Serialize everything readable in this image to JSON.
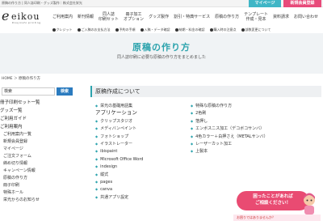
{
  "topbar": {
    "tagline": "原稿の作り方 | 同人誌印刷・グッズ製作｜株式会社栄光",
    "mypage": "マイページ",
    "register": "新規会員登録"
  },
  "header": {
    "logo_mark": "e",
    "logo_word": "eikou",
    "logo_sub": "Doujinshi printing",
    "nav": [
      "ご利用案内",
      "新刊情報",
      "同人誌\n印刷セット",
      "冊子加工\nオプション",
      "グッズ製作",
      "割引・特典サービス",
      "原稿の作り方",
      "テンプレート\n作成・見本",
      "資料請求",
      "お問い合わせ"
    ]
  },
  "subnav": [
    "クレジット",
    "ご入稿のお支払方法",
    "予約の手順",
    "入稿・データ確認",
    "納期・料金の確認",
    "購入時の注意点",
    "部数変更について"
  ],
  "hero": {
    "title": "原稿の作り方",
    "subtitle": "同人誌印刷に必要な原稿の作り方をまとめました"
  },
  "breadcrumb": "HOME ＞ 原稿の作り方",
  "sidebar": {
    "search_value": "検索",
    "search_button": "検索",
    "items": [
      {
        "label": "冊子印刷セット一覧",
        "sub": false
      },
      {
        "label": "グッズ一覧",
        "sub": false
      },
      {
        "label": "ご利用ガイド",
        "sub": false
      },
      {
        "label": "ご利用案内",
        "sub": false
      },
      {
        "label": "ご利用案内一覧",
        "sub": true
      },
      {
        "label": "新規会員登録",
        "sub": true
      },
      {
        "label": "マイページ",
        "sub": true
      },
      {
        "label": "ご注文フォーム",
        "sub": true
      },
      {
        "label": "締め切り情報",
        "sub": true
      },
      {
        "label": "キャンペーン情報",
        "sub": true
      },
      {
        "label": "原稿の作り方",
        "sub": true
      },
      {
        "label": "冊子印刷",
        "sub": true
      },
      {
        "label": "特殊ホール",
        "sub": true
      },
      {
        "label": "栄光からのお知らせ",
        "sub": true
      }
    ]
  },
  "main": {
    "section_title": "原稿作成について",
    "left": [
      {
        "type": "link",
        "label": "栄光の基礎用語集"
      },
      {
        "type": "heading",
        "label": "アプリケーション"
      },
      {
        "type": "link",
        "label": "クリップスタジオ"
      },
      {
        "type": "link",
        "label": "メディバンペイント"
      },
      {
        "type": "link",
        "label": "フォトショップ"
      },
      {
        "type": "link",
        "label": "イラストレーター"
      },
      {
        "type": "link",
        "label": "ibispaint"
      },
      {
        "type": "link",
        "label": "Microsoft Office Word"
      },
      {
        "type": "link",
        "label": "indesign"
      },
      {
        "type": "link",
        "label": "縦式"
      },
      {
        "type": "link",
        "label": "pages"
      },
      {
        "type": "link",
        "label": "canva"
      },
      {
        "type": "link",
        "label": "共通アプリ設定"
      }
    ],
    "right": [
      {
        "type": "link",
        "label": "特殊な原稿の作り方"
      },
      {
        "type": "link",
        "label": "2色刷"
      },
      {
        "type": "link",
        "label": "箔押し"
      },
      {
        "type": "link",
        "label": "エンボスニス加工（デコボコサンバ）"
      },
      {
        "type": "link",
        "label": "4色カラー＋白押さえ（METALサンバ）"
      },
      {
        "type": "link",
        "label": "レーザーカット加工"
      },
      {
        "type": "link",
        "label": "上製本"
      }
    ]
  },
  "help": {
    "bubble": "困ったことがあれば\nご相談ください！",
    "strip": "お困りではありませんか？"
  },
  "colors": {
    "accent": "#2ca3ad",
    "mypage": "#3fb6c6",
    "register": "#e84a7a",
    "search_button": "#2b7bbf"
  }
}
